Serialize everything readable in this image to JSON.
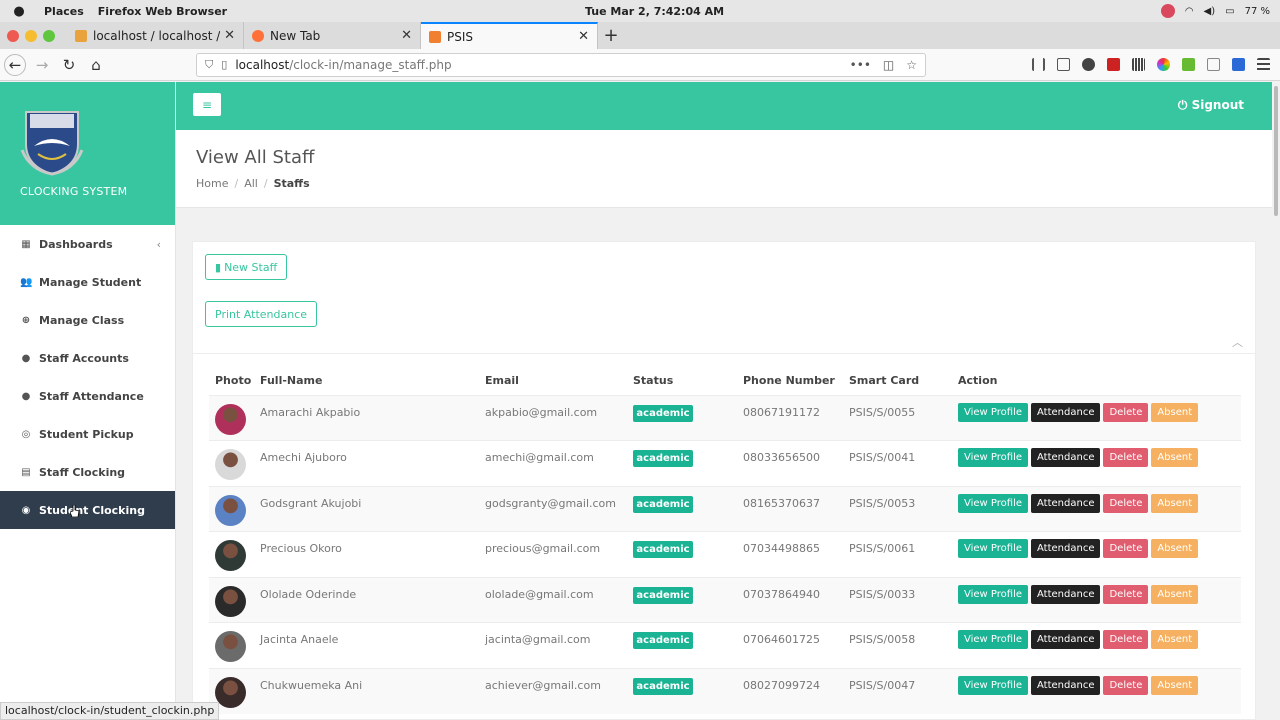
{
  "os": {
    "places": "Places",
    "app": "Firefox Web Browser",
    "clock": "Tue Mar 2,  7:42:04 AM",
    "battery": "77 %"
  },
  "tabs": [
    {
      "title": "localhost / localhost / es",
      "fav_color": "#e8a33d"
    },
    {
      "title": "New Tab",
      "fav_color": "#ff7139"
    },
    {
      "title": "PSIS",
      "fav_color": "#f08030"
    }
  ],
  "url": {
    "host": "localhost",
    "path": "/clock-in/manage_staff.php"
  },
  "sidebar": {
    "brand_title": "CLOCKING SYSTEM",
    "items": [
      {
        "label": "Dashboards",
        "icon": "▦"
      },
      {
        "label": "Manage Student",
        "icon": "👥"
      },
      {
        "label": "Manage Class",
        "icon": "⊕"
      },
      {
        "label": "Staff Accounts",
        "icon": "●"
      },
      {
        "label": "Staff Attendance",
        "icon": "●"
      },
      {
        "label": "Student Pickup",
        "icon": "◎"
      },
      {
        "label": "Staff Clocking",
        "icon": "▤"
      },
      {
        "label": "Student Clocking",
        "icon": "◉"
      }
    ]
  },
  "header": {
    "menu_icon": "≡",
    "signout": "Signout"
  },
  "page": {
    "title": "View All Staff",
    "breadcrumb": [
      "Home",
      "All",
      "Staffs"
    ]
  },
  "actions": {
    "new_staff": "New Staff",
    "print_attendance": "Print Attendance"
  },
  "table": {
    "columns": [
      "Photo",
      "Full-Name",
      "Email",
      "Status",
      "Phone Number",
      "Smart Card",
      "Action"
    ],
    "action_labels": [
      "View Profile",
      "Attendance",
      "Delete",
      "Absent"
    ],
    "rows": [
      {
        "name": "Amarachi Akpabio",
        "email": "akpabio@gmail.com",
        "status": "academic",
        "phone": "08067191172",
        "card": "PSIS/S/0055",
        "avatar_color": "#b0305c"
      },
      {
        "name": "Amechi Ajuboro",
        "email": "amechi@gmail.com",
        "status": "academic",
        "phone": "08033656500",
        "card": "PSIS/S/0041",
        "avatar_color": "#d9d9d9"
      },
      {
        "name": "Godsgrant Akujobi",
        "email": "godsgranty@gmail.com",
        "status": "academic",
        "phone": "08165370637",
        "card": "PSIS/S/0053",
        "avatar_color": "#5b82c4"
      },
      {
        "name": "Precious Okoro",
        "email": "precious@gmail.com",
        "status": "academic",
        "phone": "07034498865",
        "card": "PSIS/S/0061",
        "avatar_color": "#2f3a36"
      },
      {
        "name": "Ololade Oderinde",
        "email": "ololade@gmail.com",
        "status": "academic",
        "phone": "07037864940",
        "card": "PSIS/S/0033",
        "avatar_color": "#2a2a2a"
      },
      {
        "name": "Jacinta Anaele",
        "email": "jacinta@gmail.com",
        "status": "academic",
        "phone": "07064601725",
        "card": "PSIS/S/0058",
        "avatar_color": "#6b6b6b"
      },
      {
        "name": "Chukwuemeka Ani",
        "email": "achiever@gmail.com",
        "status": "academic",
        "phone": "08027099724",
        "card": "PSIS/S/0047",
        "avatar_color": "#3a2b2b"
      }
    ]
  },
  "status_bar": "localhost/clock-in/student_clockin.php"
}
